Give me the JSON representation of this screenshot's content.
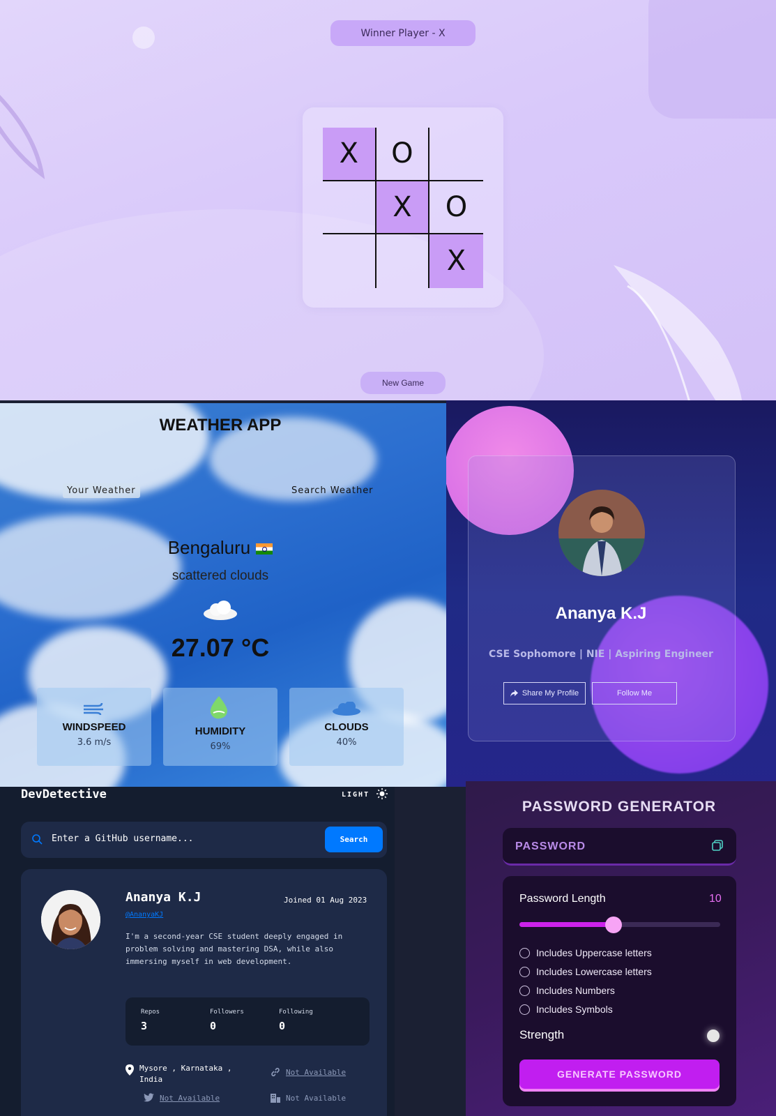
{
  "tictactoe": {
    "winner_text": "Winner Player - X",
    "cells": [
      "X",
      "O",
      "",
      "",
      "X",
      "O",
      "",
      "",
      "X"
    ],
    "winning_cells": [
      0,
      4,
      8
    ],
    "new_game_label": "New Game",
    "colors": {
      "background": "#dccffa",
      "highlight": "#c99cf6",
      "button": "#c9b0f7"
    }
  },
  "weather": {
    "title": "WEATHER APP",
    "tabs": {
      "your_weather": "Your Weather",
      "search_weather": "Search Weather"
    },
    "city": "Bengaluru",
    "flag_icon": "india-flag-icon",
    "description": "scattered clouds",
    "condition_icon": "cloud-icon",
    "temperature": "27.07 °C",
    "cards": [
      {
        "title": "WINDSPEED",
        "value": "3.6 m/s",
        "icon": "wind-icon"
      },
      {
        "title": "HUMIDITY",
        "value": "69%",
        "icon": "humidity-drop-icon"
      },
      {
        "title": "CLOUDS",
        "value": "40%",
        "icon": "cloud-icon"
      }
    ]
  },
  "profile": {
    "name": "Ananya K.J",
    "tagline": "CSE Sophomore | NIE | Aspiring Engineer",
    "share_label": "Share My Profile",
    "follow_label": "Follow Me",
    "colors": {
      "background": "#1f2a85",
      "blob_pink": "#e07ce8",
      "blob_purple": "#8a45ee"
    }
  },
  "devdetective": {
    "title": "DevDetective",
    "mode_label": "LIGHT",
    "search_placeholder": "Enter a GitHub username...",
    "search_button": "Search",
    "user": {
      "name": "Ananya K.J",
      "handle": "@AnanyaKJ",
      "joined": "Joined 01 Aug 2023",
      "bio": "I'm a second-year CSE student deeply engaged in problem solving and mastering DSA, while also immersing myself in web development."
    },
    "stats": [
      {
        "label": "Repos",
        "value": "3"
      },
      {
        "label": "Followers",
        "value": "0"
      },
      {
        "label": "Following",
        "value": "0"
      }
    ],
    "info": {
      "location": "Mysore , Karnataka , India",
      "website": "Not Available",
      "twitter": "Not Available",
      "company": "Not Available"
    },
    "colors": {
      "background": "#141d2f",
      "card": "#1e2a47",
      "accent": "#0079ff"
    }
  },
  "password_generator": {
    "title": "PASSWORD GENERATOR",
    "placeholder": "PASSWORD",
    "length_label": "Password Length",
    "length_value": "10",
    "slider_fraction": 0.47,
    "options": [
      "Includes Uppercase letters",
      "Includes Lowercase letters",
      "Includes Numbers",
      "Includes Symbols"
    ],
    "strength_label": "Strength",
    "generate_label": "GENERATE PASSWORD",
    "colors": {
      "accent": "#c11ef0",
      "panel": "#1b0d2d",
      "length_value": "#e76ff2"
    }
  }
}
